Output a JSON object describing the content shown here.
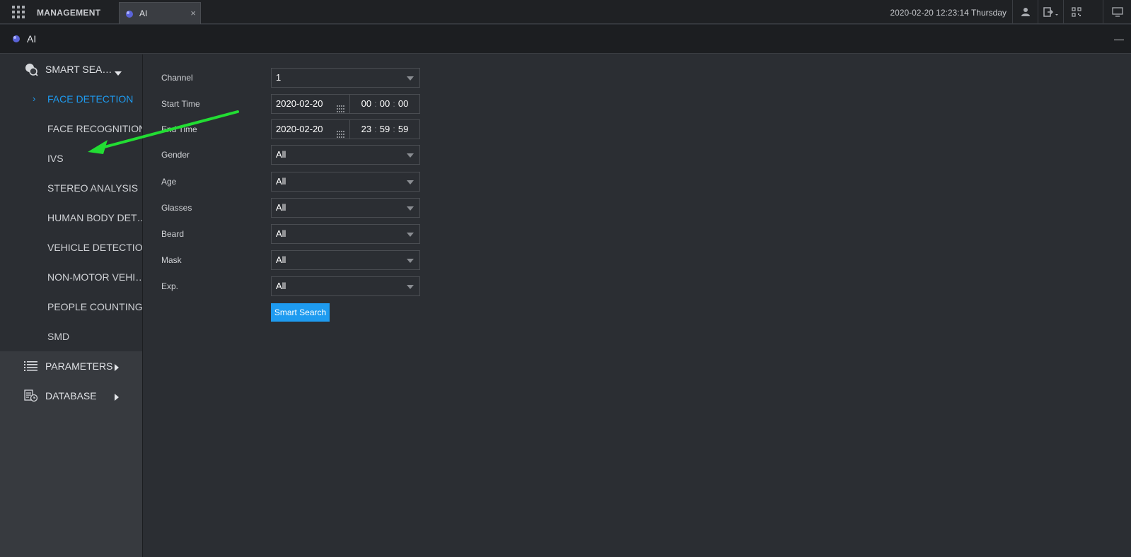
{
  "topbar": {
    "management_label": "MANAGEMENT",
    "tab_label": "AI",
    "tab_close": "×",
    "datetime": "2020-02-20 12:23:14 Thursday"
  },
  "subbar": {
    "title": "AI",
    "minimize": "—"
  },
  "sidebar": {
    "smart_search": "SMART SEA…",
    "items": [
      {
        "label": "FACE DETECTION"
      },
      {
        "label": "FACE RECOGNITION"
      },
      {
        "label": "IVS"
      },
      {
        "label": "STEREO ANALYSIS"
      },
      {
        "label": "HUMAN BODY DET…"
      },
      {
        "label": "VEHICLE DETECTION"
      },
      {
        "label": "NON-MOTOR VEHI…"
      },
      {
        "label": "PEOPLE COUNTING"
      },
      {
        "label": "SMD"
      }
    ],
    "parameters": "PARAMETERS",
    "database": "DATABASE"
  },
  "form": {
    "channel": {
      "label": "Channel",
      "value": "1"
    },
    "start_time": {
      "label": "Start Time",
      "date": "2020-02-20",
      "h": "00",
      "m": "00",
      "s": "00"
    },
    "end_time": {
      "label": "End Time",
      "date": "2020-02-20",
      "h": "23",
      "m": "59",
      "s": "59"
    },
    "gender": {
      "label": "Gender",
      "value": "All"
    },
    "age": {
      "label": "Age",
      "value": "All"
    },
    "glasses": {
      "label": "Glasses",
      "value": "All"
    },
    "beard": {
      "label": "Beard",
      "value": "All"
    },
    "mask": {
      "label": "Mask",
      "value": "All"
    },
    "exp": {
      "label": "Exp.",
      "value": "All"
    },
    "search_button": "Smart Search",
    "time_sep": ":"
  },
  "colors": {
    "accent": "#1e9bf0",
    "annotation_arrow": "#22dd33"
  }
}
